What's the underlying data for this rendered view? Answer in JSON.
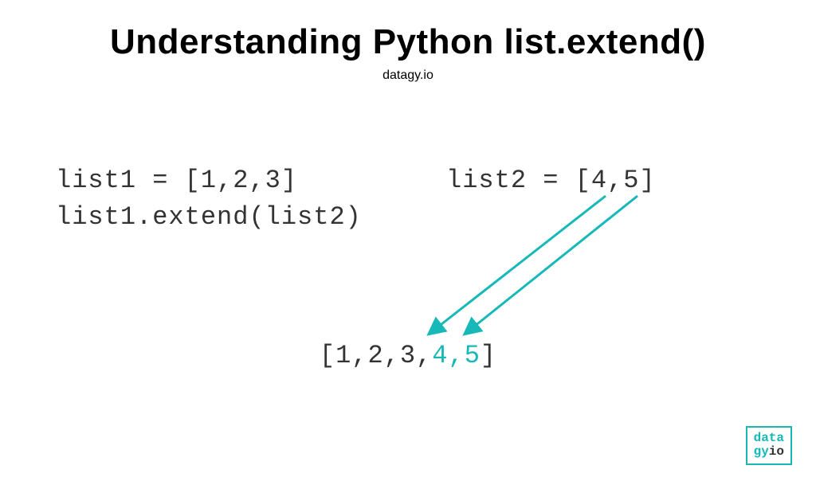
{
  "header": {
    "title": "Understanding Python list.extend()",
    "subtitle": "datagy.io"
  },
  "code": {
    "line1_left": "list1 = [1,2,3]",
    "line1_right": "list2 = [4,5]",
    "line2": "list1.extend(list2)"
  },
  "result": {
    "prefix": "[1,2,3,",
    "highlighted": "4,5",
    "suffix": "]"
  },
  "logo": {
    "line1": "data",
    "line2a": "gy",
    "line2b": "io"
  },
  "colors": {
    "accent": "#17b8b8",
    "text": "#333333"
  }
}
